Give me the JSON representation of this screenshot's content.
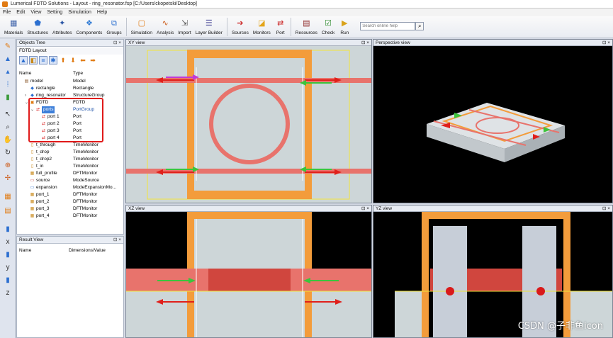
{
  "window": {
    "title": "Lumerical FDTD Solutions - Layout - ring_resonator.fsp [C:/Users/ckopetski/Desktop]"
  },
  "menu": [
    "File",
    "Edit",
    "View",
    "Setting",
    "Simulation",
    "Help"
  ],
  "toolbar": {
    "items": [
      {
        "label": "Materials",
        "icon": "materials-icon"
      },
      {
        "label": "Structures",
        "icon": "structures-icon"
      },
      {
        "label": "Attributes",
        "icon": "attributes-icon"
      },
      {
        "label": "Components",
        "icon": "components-icon"
      },
      {
        "label": "Groups",
        "icon": "groups-icon"
      },
      {
        "label": "Simulation",
        "icon": "simulation-icon"
      },
      {
        "label": "Analysis",
        "icon": "analysis-icon"
      },
      {
        "label": "Import",
        "icon": "import-icon"
      },
      {
        "label": "Layer Builder",
        "icon": "layer-builder-icon"
      },
      {
        "label": "Sources",
        "icon": "sources-icon"
      },
      {
        "label": "Monitors",
        "icon": "monitors-icon"
      },
      {
        "label": "Port",
        "icon": "port-icon"
      },
      {
        "label": "Resources",
        "icon": "resources-icon"
      },
      {
        "label": "Check",
        "icon": "check-icon"
      },
      {
        "label": "Run",
        "icon": "run-icon"
      }
    ],
    "search_placeholder": "Search online help"
  },
  "objects_tree": {
    "title": "Objects Tree",
    "subtitle": "FDTD Layout",
    "columns": {
      "name": "Name",
      "type": "Type"
    },
    "rows": [
      {
        "name": "model",
        "type": "Model",
        "indent": 0,
        "expander": "",
        "icon": "model-icon"
      },
      {
        "name": "rectangle",
        "type": "Rectangle",
        "indent": 1,
        "expander": "",
        "icon": "rectangle-icon"
      },
      {
        "name": "ring_resonator",
        "type": "StructureGroup",
        "indent": 1,
        "expander": ">",
        "icon": "structure-group-icon"
      },
      {
        "name": "FDTD",
        "type": "FDTD",
        "indent": 1,
        "expander": "v",
        "icon": "fdtd-icon"
      },
      {
        "name": "ports",
        "type": "PortGroup",
        "indent": 2,
        "expander": "v",
        "icon": "port-group-icon",
        "selected": true
      },
      {
        "name": "port 1",
        "type": "Port",
        "indent": 3,
        "expander": "",
        "icon": "port-icon"
      },
      {
        "name": "port 2",
        "type": "Port",
        "indent": 3,
        "expander": "",
        "icon": "port-icon"
      },
      {
        "name": "port 3",
        "type": "Port",
        "indent": 3,
        "expander": "",
        "icon": "port-icon"
      },
      {
        "name": "port 4",
        "type": "Port",
        "indent": 3,
        "expander": "",
        "icon": "port-icon"
      },
      {
        "name": "t_through",
        "type": "TimeMonitor",
        "indent": 1,
        "expander": "",
        "icon": "time-monitor-icon"
      },
      {
        "name": "t_drop",
        "type": "TimeMonitor",
        "indent": 1,
        "expander": "",
        "icon": "time-monitor-icon"
      },
      {
        "name": "t_drop2",
        "type": "TimeMonitor",
        "indent": 1,
        "expander": "",
        "icon": "time-monitor-icon"
      },
      {
        "name": "t_in",
        "type": "TimeMonitor",
        "indent": 1,
        "expander": "",
        "icon": "time-monitor-icon"
      },
      {
        "name": "full_profile",
        "type": "DFTMonitor",
        "indent": 1,
        "expander": "",
        "icon": "dft-monitor-icon"
      },
      {
        "name": "source",
        "type": "ModeSource",
        "indent": 1,
        "expander": "",
        "icon": "mode-source-icon"
      },
      {
        "name": "expansion",
        "type": "ModeExpansionMo...",
        "indent": 1,
        "expander": "",
        "icon": "mode-expansion-icon"
      },
      {
        "name": "port_1",
        "type": "DFTMonitor",
        "indent": 1,
        "expander": "",
        "icon": "dft-monitor-icon"
      },
      {
        "name": "port_2",
        "type": "DFTMonitor",
        "indent": 1,
        "expander": "",
        "icon": "dft-monitor-icon"
      },
      {
        "name": "port_3",
        "type": "DFTMonitor",
        "indent": 1,
        "expander": "",
        "icon": "dft-monitor-icon"
      },
      {
        "name": "port_4",
        "type": "DFTMonitor",
        "indent": 1,
        "expander": "",
        "icon": "dft-monitor-icon"
      }
    ]
  },
  "result_view": {
    "title": "Result View",
    "columns": {
      "name": "Name",
      "dims": "Dimensions/Value"
    }
  },
  "views": {
    "xy": "XY view",
    "perspective": "Perspective view",
    "xz": "XZ view",
    "yz": "YZ view"
  },
  "panel_controls": "⊡ ×",
  "watermark": "CSDN @子非鱼icon",
  "colors": {
    "waveguide": "#e8736c",
    "frame": "#f39c3b",
    "port_arrow": "#e0201b",
    "mode_arrow": "#3cc43c",
    "selection": "#3d7fd9",
    "highlight_box": "#e01a1a"
  }
}
